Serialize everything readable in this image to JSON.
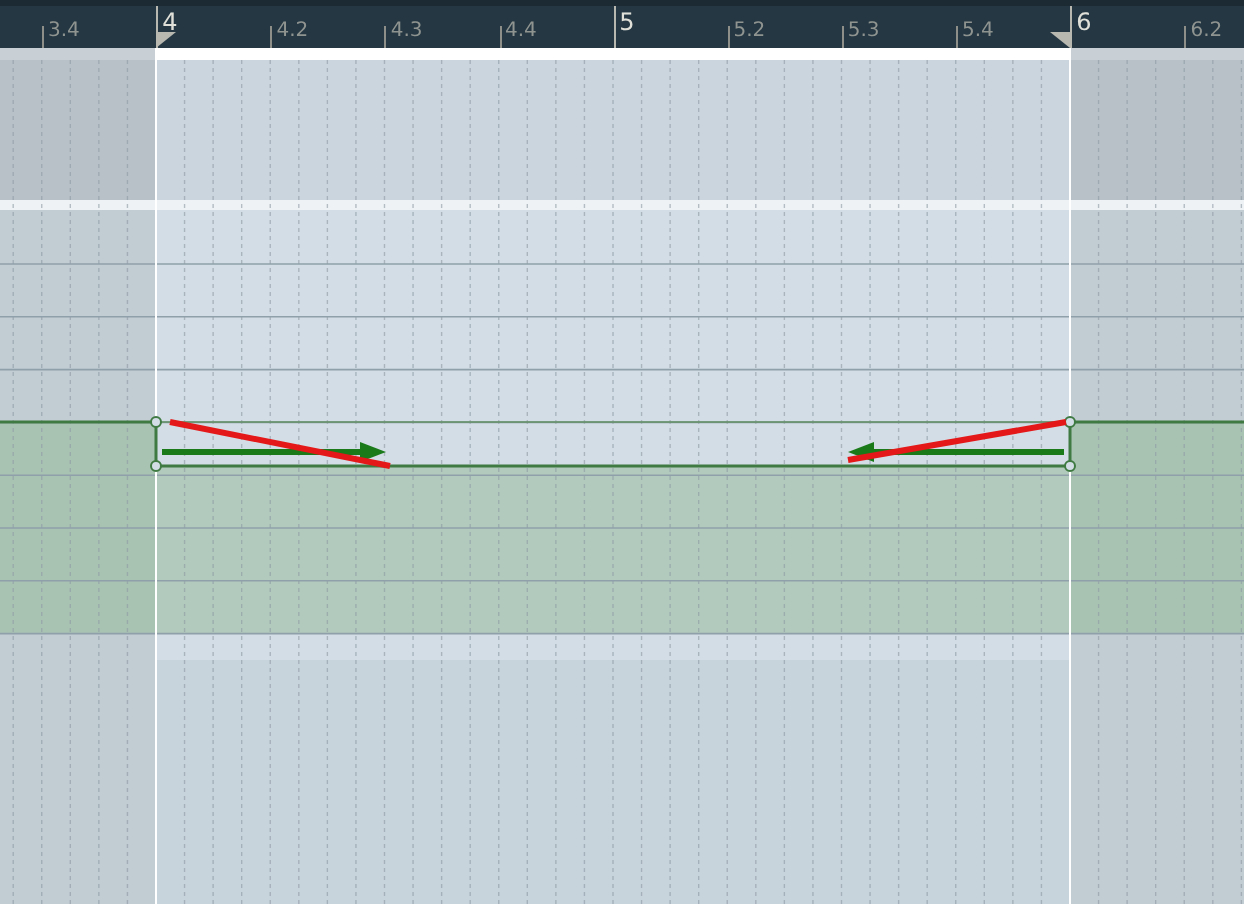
{
  "ruler": {
    "markers": [
      {
        "label": "3.4",
        "kind": "beat"
      },
      {
        "label": "4",
        "kind": "bar"
      },
      {
        "label": "4.2",
        "kind": "beat"
      },
      {
        "label": "4.3",
        "kind": "beat"
      },
      {
        "label": "4.4",
        "kind": "beat"
      },
      {
        "label": "5",
        "kind": "bar"
      },
      {
        "label": "5.2",
        "kind": "beat"
      },
      {
        "label": "5.3",
        "kind": "beat"
      },
      {
        "label": "5.4",
        "kind": "beat"
      },
      {
        "label": "6",
        "kind": "bar"
      },
      {
        "label": "6.2",
        "kind": "beat"
      }
    ]
  }
}
